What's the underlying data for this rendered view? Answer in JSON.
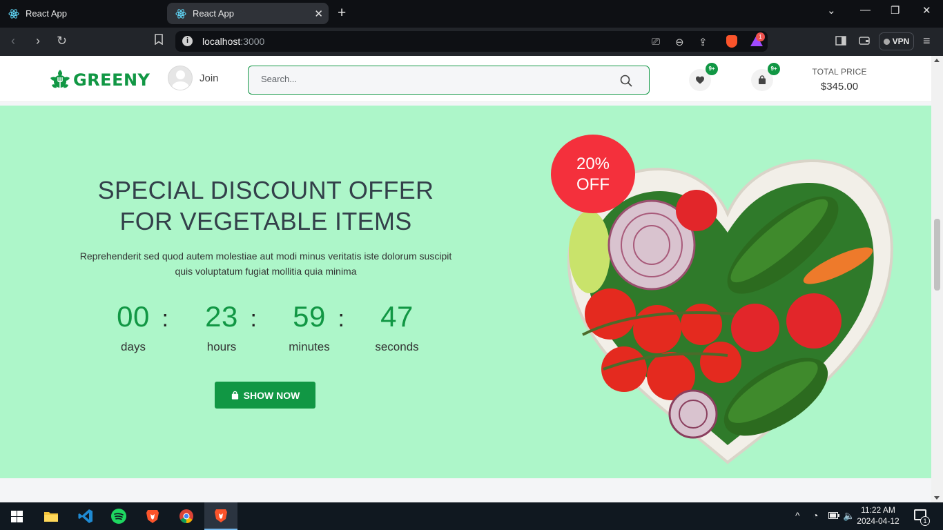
{
  "browser": {
    "tabs": [
      {
        "title": "React App"
      },
      {
        "title": "React App"
      }
    ],
    "url_host": "localhost",
    "url_port": ":3000",
    "rewards_count": "1",
    "vpn_label": "VPN"
  },
  "header": {
    "logo_text": "GREENY",
    "join_label": "Join",
    "search_placeholder": "Search...",
    "wishlist_badge": "9+",
    "cart_badge": "9+",
    "total_label": "TOTAL PRICE",
    "total_value": "$345.00"
  },
  "hero": {
    "title": "SPECIAL DISCOUNT OFFER FOR VEGETABLE ITEMS",
    "description": "Reprehenderit sed quod autem molestiae aut modi minus veritatis iste dolorum suscipit quis voluptatum fugiat mollitia quia minima",
    "countdown": [
      {
        "value": "00",
        "unit": "days"
      },
      {
        "value": "23",
        "unit": "hours"
      },
      {
        "value": "59",
        "unit": "minutes"
      },
      {
        "value": "47",
        "unit": "seconds"
      }
    ],
    "button_label": "SHOW NOW",
    "offer_line1": "20%",
    "offer_line2": "OFF"
  },
  "taskbar": {
    "time": "11:22 AM",
    "date": "2024-04-12",
    "notification_count": "1"
  },
  "colors": {
    "brand_green": "#119744",
    "hero_bg": "#adf6c9",
    "offer_red": "#f4303c"
  }
}
